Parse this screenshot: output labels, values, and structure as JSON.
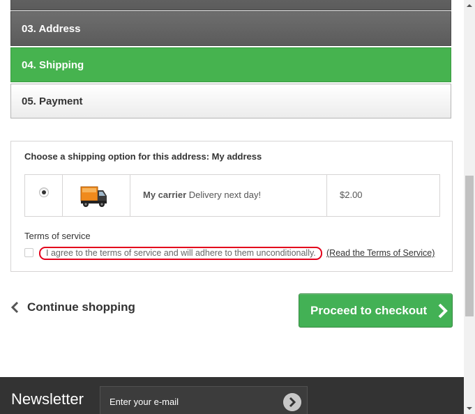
{
  "steps": {
    "address": "03. Address",
    "shipping": "04. Shipping",
    "payment": "05. Payment"
  },
  "shipping": {
    "title": "Choose a shipping option for this address: My address",
    "carrier_name": "My carrier",
    "carrier_delay": "Delivery next day!",
    "price": "$2.00",
    "selected": true
  },
  "terms": {
    "title": "Terms of service",
    "agree_text": "I agree to the terms of service and will adhere to them unconditionally.",
    "read_link": "(Read the Terms of Service)",
    "checked": false
  },
  "actions": {
    "continue_label": "Continue shopping",
    "proceed_label": "Proceed to checkout"
  },
  "newsletter": {
    "title": "Newsletter",
    "placeholder": "Enter your e-mail"
  },
  "icons": {
    "carrier": "delivery-truck-icon",
    "continue": "chevron-left-icon",
    "proceed": "chevron-right-icon",
    "submit": "circle-arrow-right-icon"
  },
  "colors": {
    "active_step": "#46b34f",
    "proceed_button": "#43b155",
    "highlight_outline": "#e3001b",
    "footer": "#333333"
  }
}
